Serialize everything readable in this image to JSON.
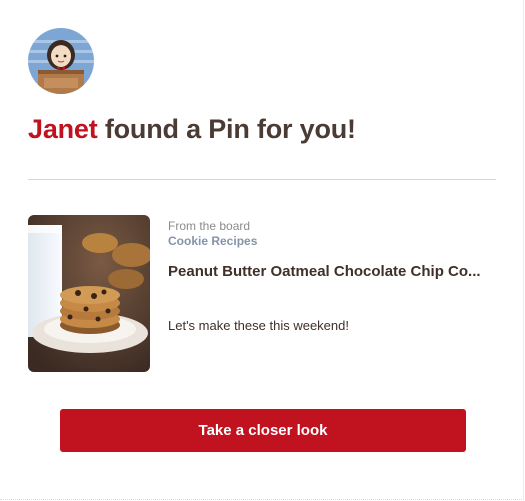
{
  "sender": {
    "name": "Janet",
    "avatar_icon": "girl-avatar-icon"
  },
  "headline": {
    "suffix": " found a Pin for you!"
  },
  "pin": {
    "board_prefix": "From the board",
    "board_name": "Cookie Recipes",
    "title": "Peanut Butter Oatmeal Chocolate Chip Co...",
    "note": "Let's make these this weekend!",
    "image_icon": "cookie-stack-image"
  },
  "cta": {
    "label": "Take a closer look"
  },
  "colors": {
    "brand_red": "#c0121f",
    "text_dark": "#4a3b34",
    "board_link": "#8594a8",
    "muted": "#8b8b8b"
  }
}
